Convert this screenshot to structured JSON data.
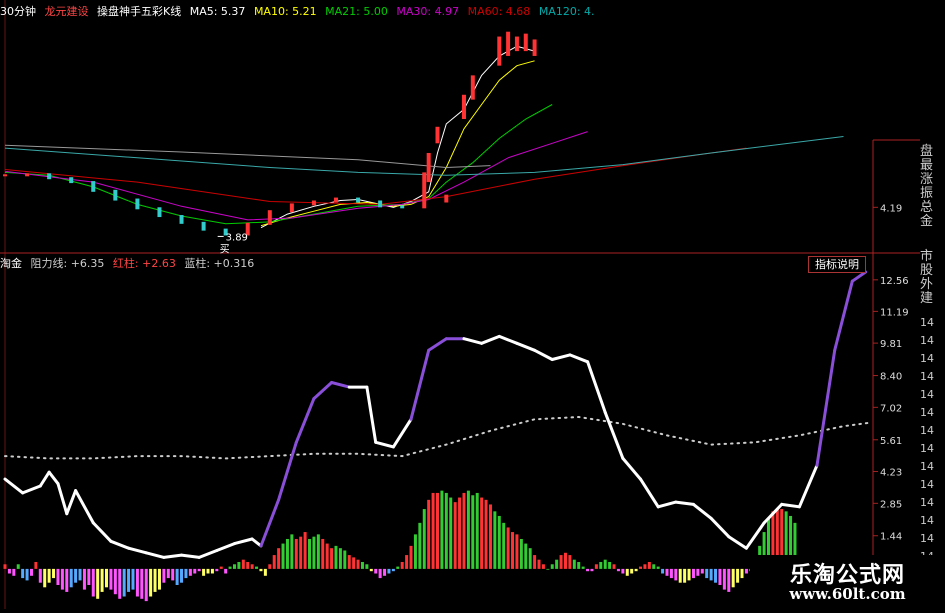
{
  "header_top": {
    "period": "30分钟",
    "stock": "龙元建设",
    "indicator": "操盘神手五彩K线",
    "ma": [
      {
        "label": "MA5: 5.37",
        "color": "#ffffff"
      },
      {
        "label": "MA10: 5.21",
        "color": "#ffff00"
      },
      {
        "label": "MA21: 5.00",
        "color": "#00cc00"
      },
      {
        "label": "MA30: 4.97",
        "color": "#cc00cc"
      },
      {
        "label": "MA60: 4.68",
        "color": "#cc0000"
      },
      {
        "label": "MA120: 4.",
        "color": "#00aaaa"
      }
    ]
  },
  "header_bottom": {
    "name": "淘金",
    "resistance": "阻力线: +6.35",
    "red": "红柱: +2.63",
    "blue": "蓝柱: +0.316",
    "button": "指标说明"
  },
  "right_panel": {
    "top_chars": [
      "盘",
      "最",
      "涨",
      "振",
      "总",
      "金"
    ],
    "mid_chars": [
      "市",
      "股",
      "外",
      "建"
    ],
    "rows": [
      "14",
      "14",
      "14",
      "14",
      "14",
      "14",
      "14",
      "14",
      "14",
      "14",
      "14",
      "14",
      "14",
      "14",
      "14",
      "14"
    ]
  },
  "watermark": {
    "title": "乐淘公式网",
    "url": "www.60lt.com"
  },
  "chart_data": [
    {
      "type": "line",
      "name": "price panel",
      "y_ticks": [
        4.19
      ],
      "ylim": [
        3.75,
        6.1
      ],
      "annotations": [
        {
          "text": "3.89"
        },
        {
          "text": "买"
        }
      ],
      "x": [
        0,
        5,
        10,
        15,
        20,
        25,
        30,
        35,
        40,
        45,
        50,
        55,
        60,
        65,
        70,
        75,
        80,
        85,
        90,
        95,
        100
      ],
      "candles_close": [
        4.52,
        4.53,
        4.49,
        4.45,
        4.36,
        4.27,
        4.18,
        4.1,
        4.03,
        3.96,
        3.91,
        4.02,
        4.15,
        4.22,
        4.25,
        4.28,
        4.25,
        4.2,
        4.19,
        4.25,
        4.31
      ],
      "candles_close_b": [
        null,
        null,
        null,
        null,
        null,
        null,
        null,
        null,
        null,
        null,
        null,
        null,
        null,
        null,
        null,
        null,
        null,
        null,
        null,
        null,
        null
      ],
      "series": [
        {
          "name": "MA5",
          "color": "#ffffff",
          "points": [
            [
              58,
              3.98
            ],
            [
              64,
              4.12
            ],
            [
              70,
              4.2
            ],
            [
              76,
              4.26
            ],
            [
              80,
              4.27
            ],
            [
              84,
              4.23
            ],
            [
              88,
              4.19
            ],
            [
              92,
              4.25
            ],
            [
              96,
              4.35
            ],
            [
              98,
              4.75
            ],
            [
              100,
              5.05
            ],
            [
              104,
              5.2
            ],
            [
              108,
              5.55
            ],
            [
              112,
              5.75
            ],
            [
              116,
              5.85
            ],
            [
              120,
              5.8
            ]
          ]
        },
        {
          "name": "MA10",
          "color": "#ffff00",
          "points": [
            [
              58,
              4.0
            ],
            [
              64,
              4.08
            ],
            [
              70,
              4.15
            ],
            [
              76,
              4.22
            ],
            [
              82,
              4.24
            ],
            [
              88,
              4.2
            ],
            [
              92,
              4.22
            ],
            [
              96,
              4.3
            ],
            [
              100,
              4.6
            ],
            [
              104,
              5.0
            ],
            [
              108,
              5.25
            ],
            [
              112,
              5.5
            ],
            [
              116,
              5.65
            ],
            [
              120,
              5.7
            ]
          ]
        },
        {
          "name": "MA21",
          "color": "#00cc00",
          "points": [
            [
              0,
              4.55
            ],
            [
              10,
              4.52
            ],
            [
              20,
              4.4
            ],
            [
              30,
              4.22
            ],
            [
              40,
              4.1
            ],
            [
              50,
              4.02
            ],
            [
              60,
              4.04
            ],
            [
              70,
              4.12
            ],
            [
              80,
              4.2
            ],
            [
              90,
              4.22
            ],
            [
              96,
              4.28
            ],
            [
              100,
              4.45
            ],
            [
              106,
              4.65
            ],
            [
              112,
              4.9
            ],
            [
              118,
              5.1
            ],
            [
              124,
              5.25
            ]
          ]
        },
        {
          "name": "MA30",
          "color": "#cc00cc",
          "points": [
            [
              0,
              4.56
            ],
            [
              20,
              4.45
            ],
            [
              40,
              4.2
            ],
            [
              55,
              4.06
            ],
            [
              65,
              4.08
            ],
            [
              80,
              4.18
            ],
            [
              90,
              4.22
            ],
            [
              96,
              4.27
            ],
            [
              104,
              4.45
            ],
            [
              114,
              4.7
            ],
            [
              124,
              4.85
            ],
            [
              132,
              4.97
            ]
          ]
        },
        {
          "name": "MA60",
          "color": "#cc0000",
          "points": [
            [
              0,
              4.58
            ],
            [
              30,
              4.45
            ],
            [
              60,
              4.25
            ],
            [
              85,
              4.22
            ],
            [
              100,
              4.3
            ],
            [
              120,
              4.48
            ],
            [
              140,
              4.62
            ],
            [
              160,
              4.75
            ],
            [
              168,
              4.8
            ]
          ]
        },
        {
          "name": "MA120",
          "color": "#3aa8a8",
          "points": [
            [
              0,
              4.8
            ],
            [
              30,
              4.7
            ],
            [
              60,
              4.6
            ],
            [
              80,
              4.55
            ],
            [
              100,
              4.52
            ],
            [
              120,
              4.55
            ],
            [
              140,
              4.63
            ],
            [
              160,
              4.75
            ],
            [
              190,
              4.92
            ]
          ]
        },
        {
          "name": "BASE",
          "color": "#999999",
          "points": [
            [
              0,
              4.83
            ],
            [
              40,
              4.76
            ],
            [
              80,
              4.68
            ],
            [
              100,
              4.6
            ],
            [
              110,
              4.62
            ]
          ]
        }
      ],
      "xlim": [
        0,
        196
      ]
    },
    {
      "type": "line",
      "name": "indicator panel",
      "y_ticks": [
        12.56,
        11.19,
        9.81,
        8.4,
        7.02,
        5.61,
        4.23,
        2.85,
        1.44
      ],
      "ylim": [
        -0.7,
        12.9
      ],
      "xlim": [
        0,
        196
      ],
      "main_line": {
        "points": [
          [
            0,
            3.9
          ],
          [
            4,
            3.3
          ],
          [
            8,
            3.6
          ],
          [
            10,
            4.2
          ],
          [
            12,
            3.7
          ],
          [
            14,
            2.4
          ],
          [
            16,
            3.4
          ],
          [
            20,
            2.0
          ],
          [
            24,
            1.2
          ],
          [
            28,
            0.9
          ],
          [
            32,
            0.7
          ],
          [
            36,
            0.5
          ],
          [
            40,
            0.6
          ],
          [
            44,
            0.5
          ],
          [
            48,
            0.8
          ],
          [
            52,
            1.1
          ],
          [
            56,
            1.3
          ],
          [
            58,
            1.0
          ],
          [
            62,
            3.0
          ],
          [
            66,
            5.5
          ],
          [
            70,
            7.4
          ],
          [
            74,
            8.1
          ],
          [
            78,
            7.9
          ],
          [
            82,
            7.9
          ],
          [
            84,
            5.5
          ],
          [
            88,
            5.3
          ],
          [
            92,
            6.5
          ],
          [
            96,
            9.5
          ],
          [
            100,
            10.0
          ],
          [
            104,
            10.0
          ],
          [
            108,
            9.8
          ],
          [
            112,
            10.1
          ],
          [
            116,
            9.8
          ],
          [
            120,
            9.5
          ],
          [
            124,
            9.1
          ],
          [
            128,
            9.3
          ],
          [
            132,
            9.0
          ],
          [
            136,
            6.8
          ],
          [
            140,
            4.8
          ],
          [
            144,
            3.9
          ],
          [
            148,
            2.7
          ],
          [
            152,
            2.9
          ],
          [
            156,
            2.8
          ],
          [
            160,
            2.2
          ],
          [
            164,
            1.4
          ],
          [
            168,
            0.9
          ],
          [
            172,
            2.0
          ],
          [
            176,
            2.8
          ],
          [
            180,
            2.7
          ],
          [
            184,
            4.5
          ],
          [
            188,
            9.5
          ],
          [
            192,
            12.5
          ],
          [
            195,
            12.9
          ]
        ],
        "up_color": "#8a4fd8",
        "down_color": "#ffffff",
        "purple_segments": [
          [
            60,
            76
          ],
          [
            92,
            104
          ],
          [
            184,
            196
          ]
        ]
      },
      "dotted_line": {
        "name": "阻力线",
        "points": [
          [
            0,
            4.9
          ],
          [
            10,
            4.8
          ],
          [
            20,
            4.8
          ],
          [
            30,
            4.9
          ],
          [
            40,
            4.9
          ],
          [
            50,
            4.8
          ],
          [
            60,
            4.9
          ],
          [
            70,
            5.0
          ],
          [
            80,
            5.0
          ],
          [
            90,
            4.9
          ],
          [
            100,
            5.4
          ],
          [
            110,
            6.0
          ],
          [
            120,
            6.5
          ],
          [
            130,
            6.6
          ],
          [
            140,
            6.3
          ],
          [
            150,
            5.8
          ],
          [
            160,
            5.4
          ],
          [
            170,
            5.5
          ],
          [
            180,
            5.8
          ],
          [
            190,
            6.2
          ],
          [
            196,
            6.35
          ]
        ],
        "color": "#cccccc"
      },
      "histogram": {
        "x_start": 0,
        "x_step": 1,
        "values": [
          0.2,
          -0.2,
          -0.3,
          0.2,
          -0.4,
          -0.5,
          -0.3,
          0.3,
          -0.6,
          -0.8,
          -0.6,
          -0.4,
          -0.7,
          -0.9,
          -1.0,
          -0.8,
          -0.6,
          -0.5,
          -0.9,
          -0.7,
          -1.2,
          -1.3,
          -1.0,
          -0.8,
          -0.9,
          -1.1,
          -1.3,
          -1.2,
          -1.0,
          -0.9,
          -1.2,
          -1.3,
          -1.4,
          -1.2,
          -1.0,
          -0.9,
          -0.6,
          -0.4,
          -0.5,
          -0.7,
          -0.6,
          -0.4,
          -0.3,
          -0.2,
          -0.1,
          -0.3,
          -0.2,
          -0.2,
          -0.1,
          0.1,
          -0.2,
          0.1,
          0.2,
          0.3,
          0.4,
          0.3,
          0.2,
          0.1,
          -0.1,
          -0.3,
          0.2,
          0.6,
          0.9,
          1.1,
          1.3,
          1.5,
          1.3,
          1.4,
          1.6,
          1.3,
          1.4,
          1.5,
          1.3,
          1.1,
          0.9,
          1.0,
          0.9,
          0.8,
          0.6,
          0.5,
          0.4,
          0.3,
          0.2,
          -0.1,
          -0.2,
          -0.4,
          -0.3,
          -0.2,
          -0.1,
          0.1,
          0.3,
          0.6,
          1.0,
          1.5,
          2.0,
          2.6,
          3.0,
          3.3,
          3.3,
          3.4,
          3.3,
          3.1,
          2.9,
          3.1,
          3.3,
          3.4,
          3.2,
          3.3,
          3.1,
          3.0,
          2.8,
          2.5,
          2.3,
          2.0,
          1.8,
          1.6,
          1.5,
          1.3,
          1.1,
          0.9,
          0.6,
          0.4,
          0.2,
          0.0,
          0.2,
          0.4,
          0.6,
          0.7,
          0.6,
          0.4,
          0.3,
          0.1,
          -0.1,
          -0.1,
          0.2,
          0.3,
          0.4,
          0.3,
          0.2,
          -0.1,
          -0.2,
          -0.3,
          -0.2,
          -0.1,
          0.1,
          0.2,
          0.3,
          0.2,
          0.1,
          -0.2,
          -0.3,
          -0.4,
          -0.5,
          -0.6,
          -0.6,
          -0.5,
          -0.4,
          -0.3,
          -0.2,
          -0.4,
          -0.5,
          -0.6,
          -0.7,
          -0.9,
          -1.0,
          -0.8,
          -0.6,
          -0.4,
          -0.2,
          -0.1,
          0.3,
          1.0,
          1.6,
          2.2,
          2.5,
          2.6,
          2.6,
          2.5,
          2.3,
          2.0
        ],
        "pos_colors": [
          "#ff3333",
          "#33cc33",
          "#ff3333",
          "#33cc33"
        ],
        "neg_colors": [
          "#ff55ff",
          "#55aaff",
          "#ff55ff",
          "#ffff66"
        ],
        "width": 3
      }
    }
  ]
}
